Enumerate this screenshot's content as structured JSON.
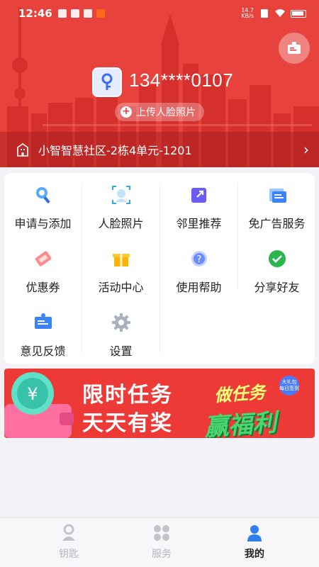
{
  "status_bar": {
    "time": "12:46",
    "net_speed": "14.7",
    "net_unit": "KB/s"
  },
  "header": {
    "phone": "134****0107",
    "upload_face_label": "上传人脸照片",
    "community": "小智智慧社区-2栋4单元-1201",
    "scan_icon": "id-card-icon"
  },
  "grid": [
    {
      "label": "申请与添加",
      "icon": "search-key-icon",
      "color": "#3b82f6"
    },
    {
      "label": "人脸照片",
      "icon": "face-icon",
      "color": "#3aa7e0"
    },
    {
      "label": "邻里推荐",
      "icon": "share-icon",
      "color": "#6a5cf5"
    },
    {
      "label": "免广告服务",
      "icon": "ad-free-icon",
      "color": "#3b82f6"
    },
    {
      "label": "优惠券",
      "icon": "coupon-icon",
      "color": "#ff6b6b"
    },
    {
      "label": "活动中心",
      "icon": "gift-icon",
      "color": "#ffb300"
    },
    {
      "label": "使用帮助",
      "icon": "help-icon",
      "color": "#6a8cff"
    },
    {
      "label": "分享好友",
      "icon": "wechat-icon",
      "color": "#2bb54d"
    },
    {
      "label": "意见反馈",
      "icon": "feedback-icon",
      "color": "#3b82f6"
    },
    {
      "label": "设置",
      "icon": "settings-icon",
      "color": "#a9b0c2"
    }
  ],
  "banner": {
    "line1": "限时任务",
    "line2": "天天有奖",
    "tag1": "做任务",
    "tag2": "赢福利",
    "sticker": "大礼包 每日签到"
  },
  "tabbar": [
    {
      "label": "钥匙",
      "icon": "key-icon",
      "active": false
    },
    {
      "label": "服务",
      "icon": "services-icon",
      "active": false
    },
    {
      "label": "我的",
      "icon": "profile-icon",
      "active": true
    }
  ]
}
